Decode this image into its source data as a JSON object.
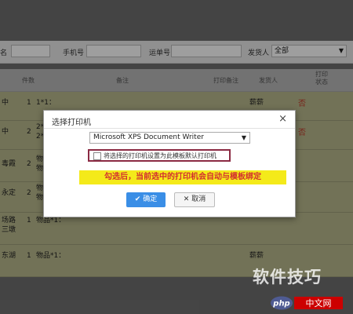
{
  "filter": {
    "field1_label": "名",
    "field2_label": "手机号",
    "field3_label": "运单号",
    "field4_label": "发货人",
    "field4_value": "全部"
  },
  "table": {
    "headers": {
      "count": "件数",
      "info": "备注",
      "print_remark": "打印备注",
      "sender": "发货人",
      "print_status": "打印 状态"
    },
    "rows": [
      {
        "lead": "中",
        "count": "1",
        "items": "1*1：",
        "sender": "薪薪",
        "status": "否"
      },
      {
        "lead": "中",
        "count": "2",
        "items": "2*\n2*",
        "sender": "",
        "status": "否"
      },
      {
        "lead": "毒霞",
        "count": "2",
        "items": "物\n物",
        "sender": "",
        "status": ""
      },
      {
        "lead": "永定",
        "count": "2",
        "items": "物\n物",
        "sender": "",
        "status": ""
      },
      {
        "lead": "场路\n三墩",
        "count": "1",
        "items": "物品*1：",
        "sender": "",
        "status": ""
      },
      {
        "lead": "东湖",
        "count": "1",
        "items": "物品*1：",
        "sender": "薪薪",
        "status": ""
      }
    ]
  },
  "dialog": {
    "title": "选择打印机",
    "close": "×",
    "printer_value": "Microsoft XPS Document Writer",
    "checkbox_label": "将选择的打印机设置为此模板默认打印机",
    "banner": "勾选后，当前选中的打印机会自动与模板绑定",
    "ok_label": "确定",
    "cancel_label": "取消",
    "ok_icon": "check-icon",
    "cancel_icon": "x-icon"
  },
  "watermark": {
    "text": "软件技巧",
    "logo_text": "php中文网"
  },
  "colors": {
    "row_bg": "#b9b98d",
    "highlight_banner": "#f4ea1a",
    "banner_text": "#d32f2f",
    "ok_button": "#3a8ee6",
    "checkbox_border": "#8b2a43"
  }
}
